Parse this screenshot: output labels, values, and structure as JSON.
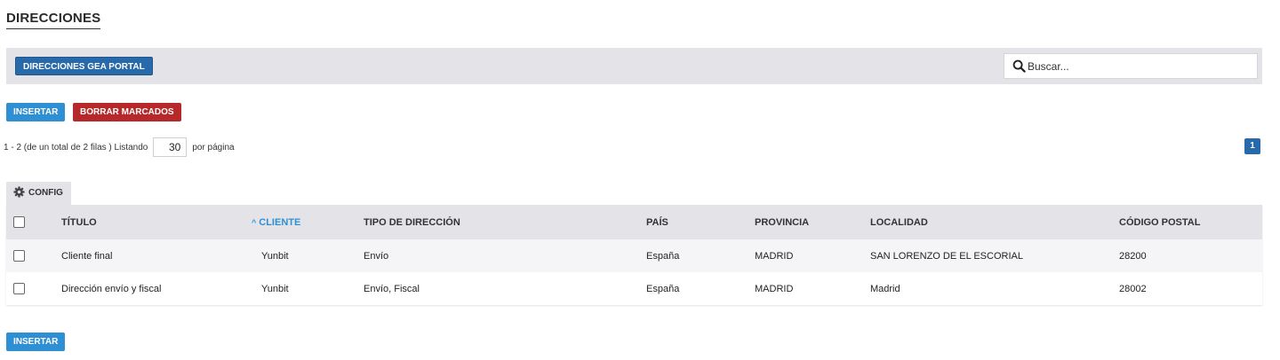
{
  "page": {
    "title": "DIRECCIONES"
  },
  "toolbar": {
    "portal_button": "DIRECCIONES GEA PORTAL",
    "search_placeholder": "Buscar..."
  },
  "actions": {
    "insert_label": "INSERTAR",
    "delete_marked_label": "BORRAR MARCADOS"
  },
  "paging": {
    "summary": "1 - 2 (de un total de 2 filas ) Listando",
    "per_page": "30",
    "per_page_suffix": "por página",
    "current_page": "1"
  },
  "config": {
    "label": "CONFIG"
  },
  "table": {
    "headers": {
      "titulo": "TÍTULO",
      "cliente": "CLIENTE",
      "tipo": "TIPO DE DIRECCIÓN",
      "pais": "PAÍS",
      "provincia": "PROVINCIA",
      "localidad": "LOCALIDAD",
      "cp": "CÓDIGO POSTAL"
    },
    "sort": {
      "column": "cliente",
      "direction": "ascending"
    },
    "rows": [
      {
        "titulo": "Cliente final",
        "cliente": "Yunbit",
        "tipo": "Envío",
        "pais": "España",
        "provincia": "MADRID",
        "localidad": "SAN LORENZO DE EL ESCORIAL",
        "cp": "28200"
      },
      {
        "titulo": "Dirección envío y fiscal",
        "cliente": "Yunbit",
        "tipo": "Envío, Fiscal",
        "pais": "España",
        "provincia": "MADRID",
        "localidad": "Madrid",
        "cp": "28002"
      }
    ]
  },
  "icons": {
    "search": "search-icon",
    "config": "gear-icon",
    "sort": "chevron-up-icon"
  },
  "colors": {
    "primary": "#2869a9",
    "accent": "#2f8fd3",
    "danger": "#b7282a",
    "toolbar_bg": "#e4e4e8"
  }
}
